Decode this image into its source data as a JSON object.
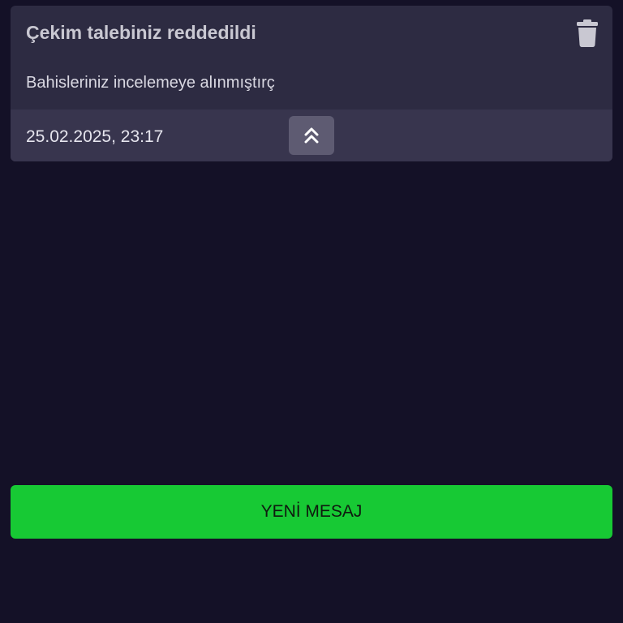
{
  "message": {
    "title": "Çekim talebiniz reddedildi",
    "body": "Bahisleriniz incelemeye alınmıştırç",
    "datetime": "25.02.2025, 23:17",
    "delete_icon": "trash-icon",
    "collapse_icon": "chevrons-up-icon"
  },
  "actions": {
    "new_message_label": "YENİ MESAJ"
  },
  "colors": {
    "background": "#141127",
    "card": "#2d2b42",
    "card_footer": "#38354e",
    "accent_green": "#17c934"
  }
}
